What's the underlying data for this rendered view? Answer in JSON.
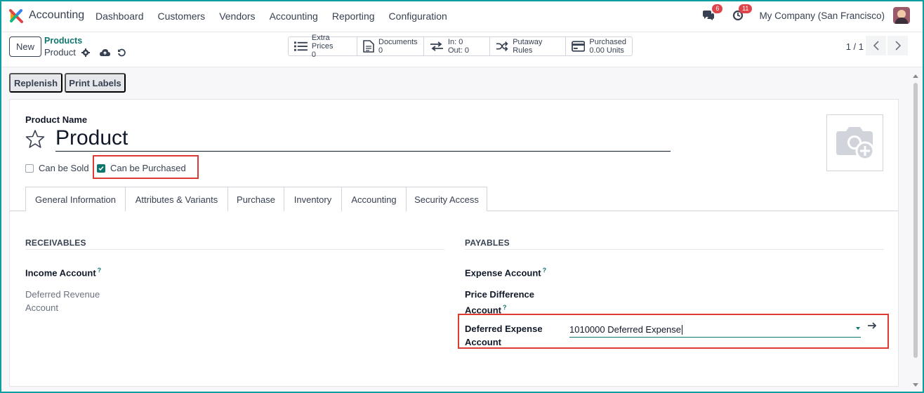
{
  "app": {
    "name": "Accounting"
  },
  "menu": [
    "Dashboard",
    "Customers",
    "Vendors",
    "Accounting",
    "Reporting",
    "Configuration"
  ],
  "systray": {
    "messages_count": "6",
    "activities_count": "11",
    "company": "My Company (San Francisco)"
  },
  "control": {
    "new_label": "New",
    "breadcrumb": "Products",
    "record_name": "Product",
    "pager": "1 / 1"
  },
  "stats": [
    {
      "label": "Extra Prices",
      "value": "0",
      "icon": "list-icon"
    },
    {
      "label": "Documents",
      "value": "0",
      "icon": "document-icon"
    },
    {
      "label": "In: 0",
      "value": "Out: 0",
      "icon": "transfer-arrows-icon"
    },
    {
      "label": "Putaway Rules",
      "value": "",
      "icon": "shuffle-icon"
    },
    {
      "label": "Purchased",
      "value": "0.00 Units",
      "icon": "credit-card-icon"
    }
  ],
  "actions": {
    "replenish": "Replenish",
    "print_labels": "Print Labels"
  },
  "form": {
    "product_name_label": "Product Name",
    "product_name": "Product",
    "can_be_sold_label": "Can be Sold",
    "can_be_sold": false,
    "can_be_purchased_label": "Can be Purchased",
    "can_be_purchased": true
  },
  "tabs": [
    "General Information",
    "Attributes & Variants",
    "Purchase",
    "Inventory",
    "Accounting",
    "Security Access"
  ],
  "active_tab": "Accounting",
  "receivables": {
    "heading": "RECEIVABLES",
    "income_account_label": "Income Account",
    "deferred_revenue_label_1": "Deferred Revenue",
    "deferred_revenue_label_2": "Account"
  },
  "payables": {
    "heading": "PAYABLES",
    "expense_account_label": "Expense Account",
    "price_diff_label_1": "Price Difference",
    "price_diff_label_2": "Account",
    "deferred_expense_label_1": "Deferred Expense",
    "deferred_expense_label_2": "Account",
    "deferred_expense_value": "1010000 Deferred Expense"
  },
  "help_mark": "?",
  "colors": {
    "accent": "#0f766e",
    "highlight": "#dc3a32",
    "badge": "#e0444b"
  }
}
